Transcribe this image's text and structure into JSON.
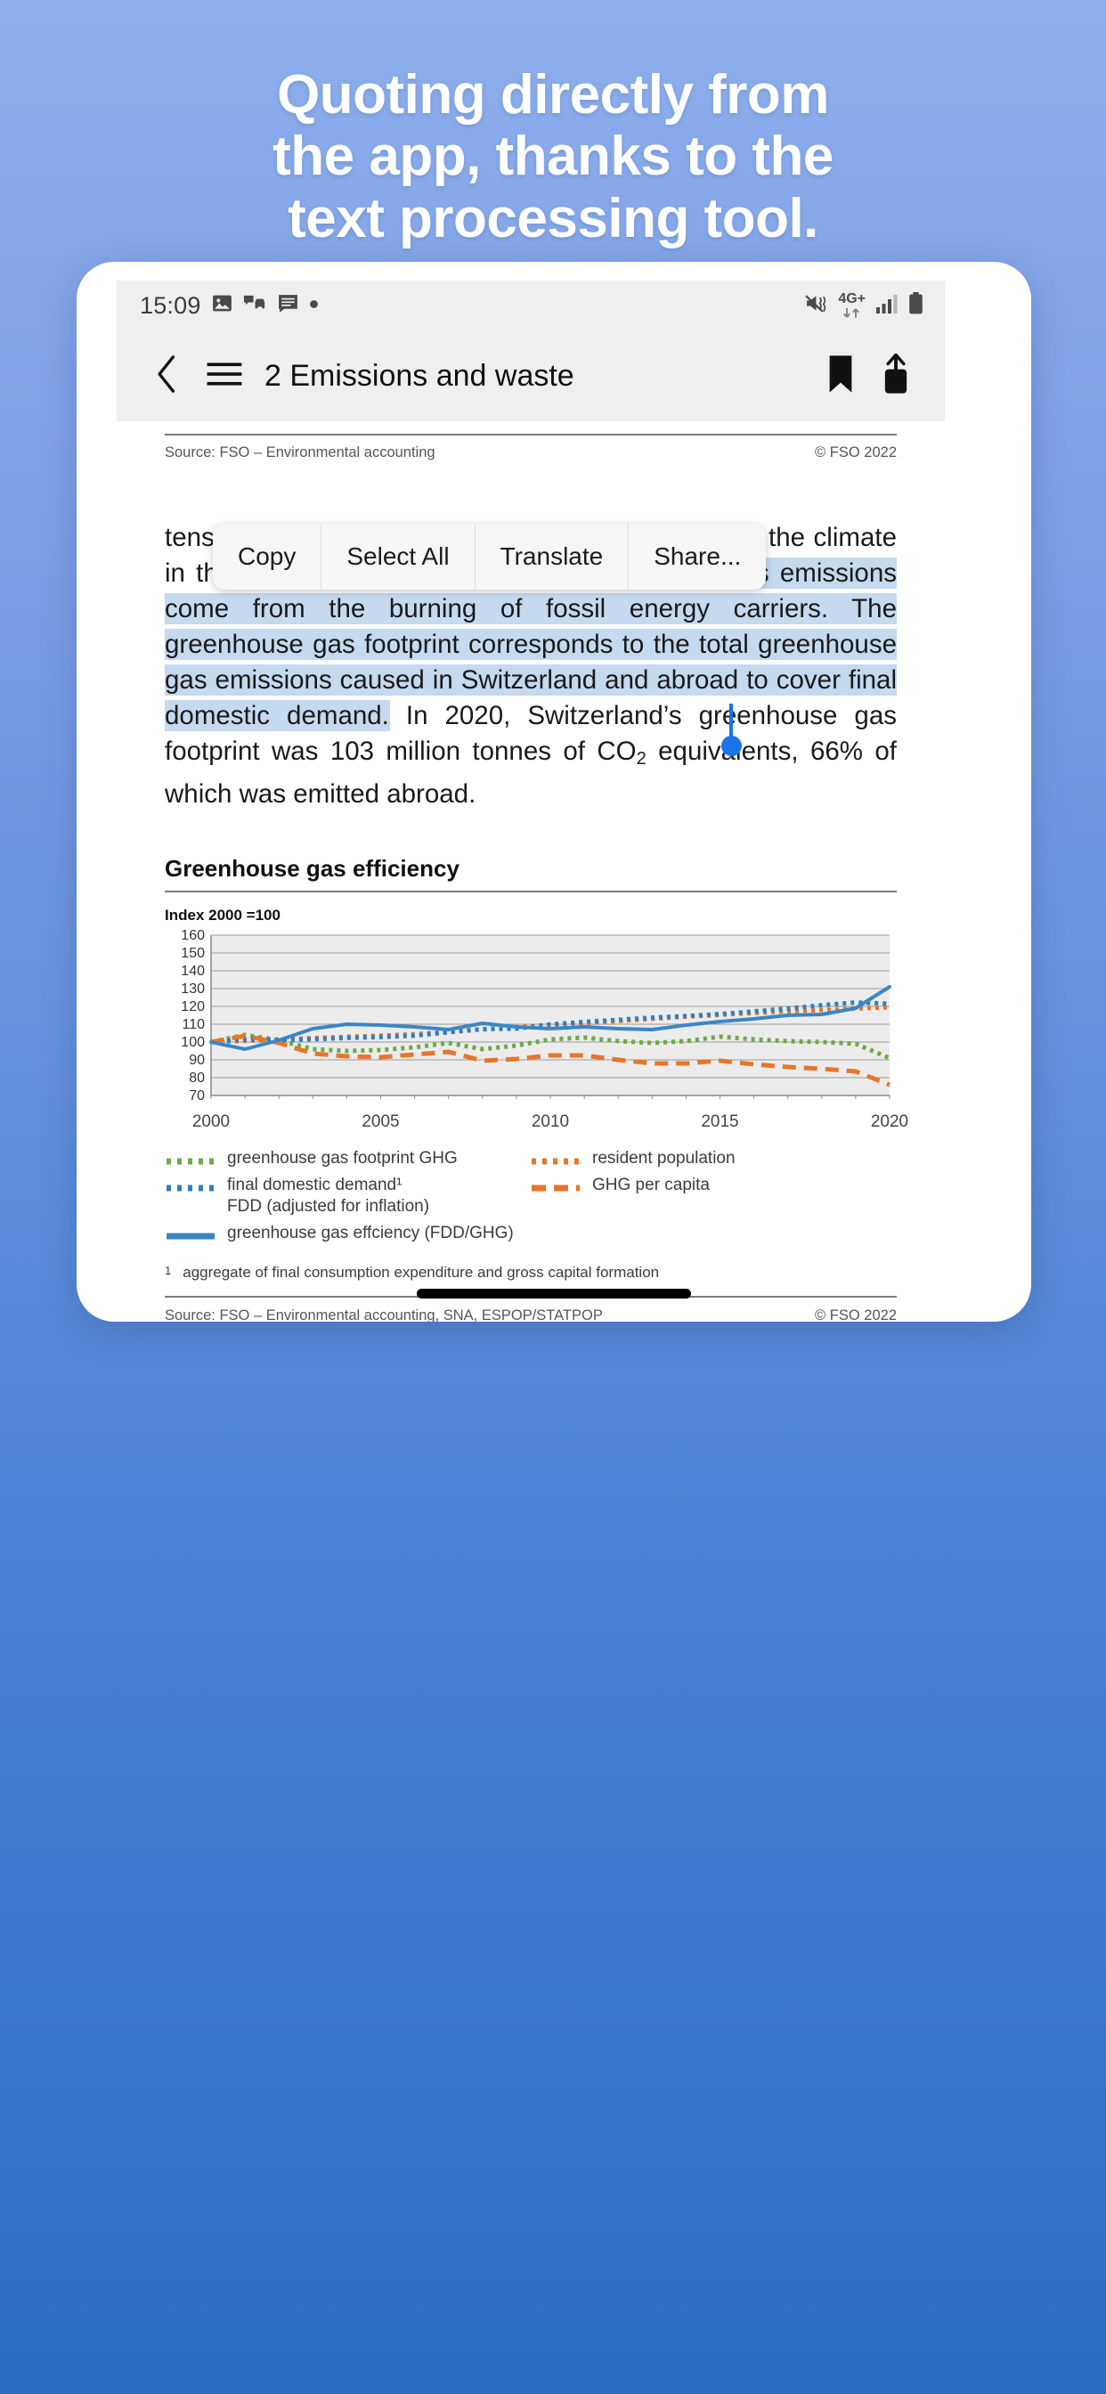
{
  "promo": {
    "line1": "Quoting directly from",
    "line2": "the app, thanks to the",
    "line3": "text processing tool."
  },
  "statusbar": {
    "time": "15:09",
    "left_icons": [
      "image-icon",
      "car-message-icon",
      "message-icon",
      "dot-icon"
    ],
    "network_label": "4G+",
    "right_icons": [
      "vibrate-off-icon",
      "data-transfer-icon",
      "signal-bars-icon",
      "battery-icon"
    ]
  },
  "appbar": {
    "back_icon": "chevron-left-icon",
    "menu_icon": "hamburger-menu-icon",
    "title": "2 Emissions and waste",
    "bookmark_icon": "bookmark-icon",
    "share_icon": "share-icon"
  },
  "top_source": {
    "source": "Source: FSO – Environmental accounting",
    "copyright": "© FSO 2022"
  },
  "context_menu": {
    "items": [
      {
        "label": "Copy"
      },
      {
        "label": "Select All"
      },
      {
        "label": "Translate"
      },
      {
        "label": "Share..."
      }
    ]
  },
  "body": {
    "pre_clipped": "[",
    "part_before": "tensity the natural greenhouse effect and influence the climate in this way. ",
    "selected": "The majority of these greenhouse gas emissions come from the burning of fossil energy carriers. The greenhouse gas footprint corresponds to the total greenhouse gas emissions caused in Switzerland and abroad to cover final domestic demand.",
    "part_after_1": " In 2020, Switzerland’s greenhouse gas footprint was 103 million tonnes of CO",
    "part_after_sub": "2",
    "part_after_2": " equivalents, 66% of which was emitted abroad."
  },
  "chart_data": {
    "type": "line",
    "title": "Greenhouse gas efficiency",
    "subtitle": "Index 2000 =100",
    "xlabel": "",
    "ylabel": "",
    "xlim": [
      2000,
      2020
    ],
    "ylim": [
      70,
      160
    ],
    "yticks": [
      70,
      80,
      90,
      100,
      110,
      120,
      130,
      140,
      150,
      160
    ],
    "xticks": [
      2000,
      2005,
      2010,
      2015,
      2020
    ],
    "grid": true,
    "legend_position": "bottom",
    "x": [
      2000,
      2001,
      2002,
      2003,
      2004,
      2005,
      2006,
      2007,
      2008,
      2009,
      2010,
      2011,
      2012,
      2013,
      2014,
      2015,
      2016,
      2017,
      2018,
      2019,
      2020
    ],
    "series": [
      {
        "name": "greenhouse gas footprint GHG",
        "color": "#6eaa46",
        "style": "dotted",
        "values": [
          100,
          104,
          101,
          96,
          95,
          95.5,
          97,
          99.5,
          96,
          98,
          101.5,
          102.5,
          100.5,
          99.5,
          100.5,
          103,
          101.5,
          100.5,
          100,
          99,
          91
        ]
      },
      {
        "name": "resident population",
        "color": "#e8752a",
        "style": "dotted",
        "values": [
          100,
          100.6,
          101.4,
          102.2,
          102.9,
          103.6,
          104.4,
          105.6,
          107.1,
          108.4,
          109.5,
          110.6,
          111.8,
          113.0,
          114.2,
          115.3,
          116.3,
          117.2,
          118.0,
          118.8,
          119.5
        ]
      },
      {
        "name": "final domestic demand¹ FDD (adjusted for inflation)",
        "color": "#2f7fc1",
        "style": "dotted",
        "values": [
          100,
          101.5,
          101.2,
          101.6,
          102.3,
          102.8,
          103.6,
          105.5,
          107.3,
          107.5,
          109.9,
          111.3,
          112.5,
          113.7,
          114.6,
          115.7,
          117.2,
          118.8,
          120.7,
          122.2,
          121.5
        ]
      },
      {
        "name": "GHG per capita",
        "color": "#e8752a",
        "style": "dashed",
        "values": [
          100,
          103.5,
          99.5,
          93.5,
          92,
          91.5,
          93,
          94.5,
          89.5,
          90.5,
          92.5,
          92.5,
          90,
          88,
          88,
          89.5,
          87.5,
          86,
          85,
          83.5,
          76
        ]
      },
      {
        "name": "greenhouse gas effciency (FDD/GHG)",
        "color": "#3a86c8",
        "style": "solid",
        "values": [
          100,
          96,
          101,
          107.5,
          110,
          109.5,
          108.5,
          107,
          110.5,
          108.5,
          107.5,
          108.5,
          107.5,
          107,
          109.5,
          111.5,
          113,
          115,
          115.5,
          119,
          131
        ]
      }
    ],
    "legend": [
      {
        "label": "greenhouse gas footprint GHG",
        "color": "#6eaa46",
        "style": "dotted",
        "col": 1
      },
      {
        "label": "resident population",
        "color": "#e8752a",
        "style": "dotted",
        "col": 2
      },
      {
        "label": "final domestic demand¹",
        "label_cont": "FDD (adjusted for inflation)",
        "color": "#2f7fc1",
        "style": "dotted",
        "col": 1
      },
      {
        "label": "GHG per capita",
        "color": "#e8752a",
        "style": "dashed",
        "col": 2
      },
      {
        "label": "greenhouse gas effciency (FDD/GHG)",
        "color": "#3a86c8",
        "style": "solid",
        "col": 1
      }
    ]
  },
  "chart_footnote": {
    "mark": "1",
    "text": "aggregate of final consumption expenditure and gross capital formation"
  },
  "bottom_source": {
    "source": "Source: FSO – Environmental accounting, SNA, ESPOP/STATPOP",
    "copyright": "© FSO 2022"
  }
}
